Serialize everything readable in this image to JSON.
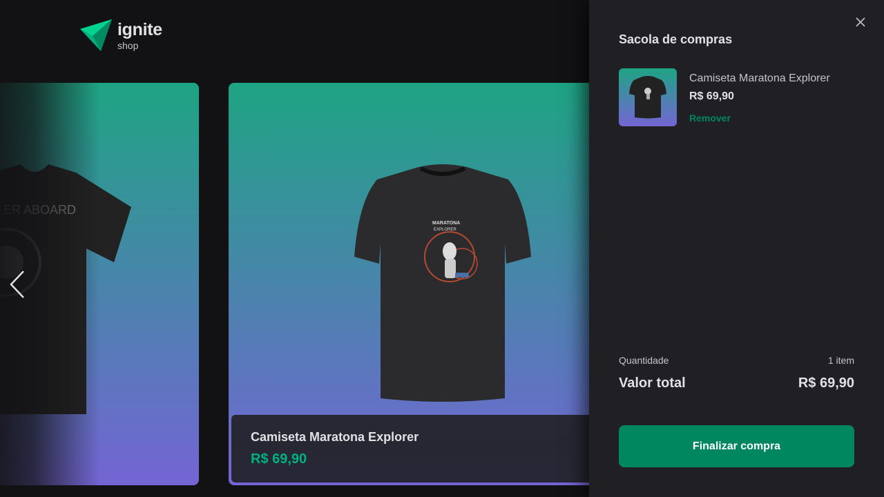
{
  "brand": {
    "title": "ignite",
    "subtitle": "shop",
    "logo_icon": "triangle-logo-icon",
    "color": "#00b37e"
  },
  "products": [
    {
      "name": "Camiseta Maratona Explorer",
      "price": "R$ 69,90"
    }
  ],
  "carousel": {
    "prev_icon": "chevron-left-icon"
  },
  "cart": {
    "title": "Sacola de compras",
    "close_icon": "close-icon",
    "items": [
      {
        "name": "Camiseta Maratona Explorer",
        "price": "R$ 69,90",
        "remove_label": "Remover"
      }
    ],
    "quantity_label": "Quantidade",
    "quantity_value": "1 item",
    "total_label": "Valor total",
    "total_value": "R$ 69,90",
    "checkout_label": "Finalizar compra"
  },
  "colors": {
    "background": "#121214",
    "panel": "#202024",
    "accent": "#00875f",
    "price": "#00b37e",
    "gradient_top": "#1ea483",
    "gradient_bottom": "#7465d4"
  }
}
